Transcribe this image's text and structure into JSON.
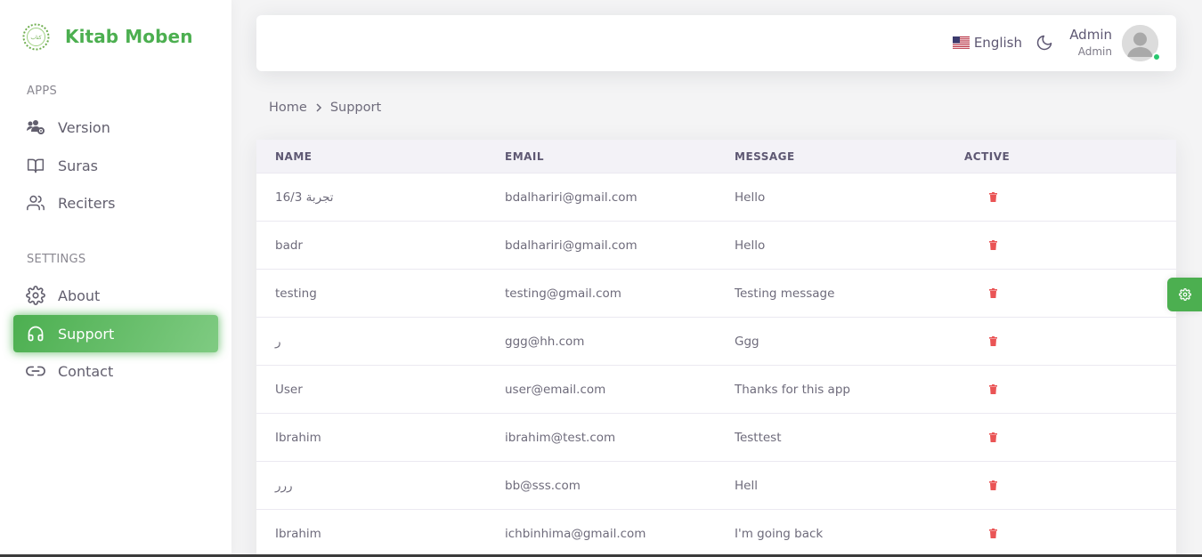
{
  "brand": {
    "name": "Kitab Moben"
  },
  "sidebar": {
    "sections": [
      {
        "header": "APPS"
      },
      {
        "header": "SETTINGS"
      }
    ],
    "items": [
      {
        "label": "Version",
        "icon": "users-cog-icon"
      },
      {
        "label": "Suras",
        "icon": "book-open-icon"
      },
      {
        "label": "Reciters",
        "icon": "users-icon"
      },
      {
        "label": "About",
        "icon": "settings-icon"
      },
      {
        "label": "Support",
        "icon": "headphones-icon",
        "active": true
      },
      {
        "label": "Contact",
        "icon": "link-icon"
      }
    ]
  },
  "navbar": {
    "language": "English",
    "user_name": "Admin",
    "user_role": "Admin"
  },
  "breadcrumb": {
    "home": "Home",
    "current": "Support"
  },
  "table": {
    "columns": [
      "NAME",
      "EMAIL",
      "MESSAGE",
      "ACTIVE"
    ],
    "rows": [
      {
        "name": "تجربة 16/3",
        "email": "bdalhariri@gmail.com",
        "message": "Hello"
      },
      {
        "name": "badr",
        "email": "bdalhariri@gmail.com",
        "message": "Hello"
      },
      {
        "name": "testing",
        "email": "testing@gmail.com",
        "message": "Testing message"
      },
      {
        "name": "ر",
        "email": "ggg@hh.com",
        "message": "Ggg"
      },
      {
        "name": "User",
        "email": "user@email.com",
        "message": "Thanks for this app"
      },
      {
        "name": "Ibrahim",
        "email": "ibrahim@test.com",
        "message": "Testtest"
      },
      {
        "name": "ررر",
        "email": "bb@sss.com",
        "message": "Hell"
      },
      {
        "name": "Ibrahim",
        "email": "ichbinhima@gmail.com",
        "message": "I'm going back"
      }
    ]
  },
  "colors": {
    "accent": "#4caf50",
    "danger": "#ea5455",
    "online": "#28c76f"
  }
}
